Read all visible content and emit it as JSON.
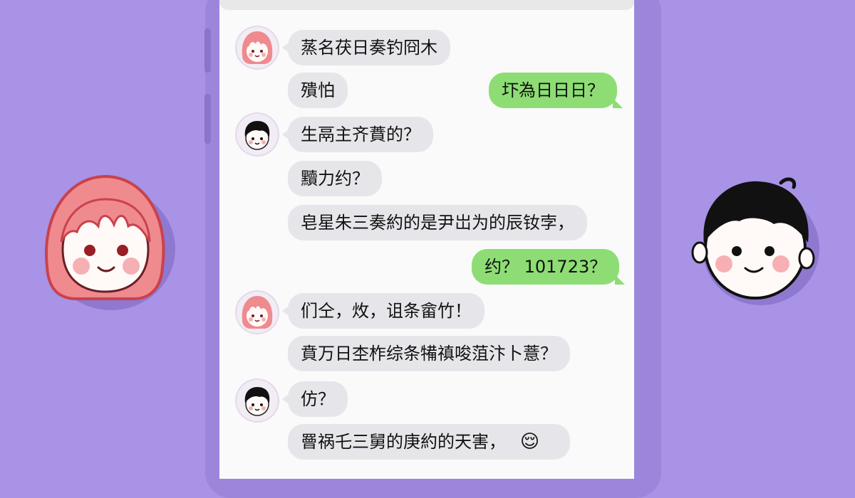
{
  "messages": [
    {
      "side": "left",
      "avatar": "girl",
      "text": "蒸名茯日奏钓冏木"
    },
    {
      "side": "left",
      "avatar": "",
      "text": "殨怕"
    },
    {
      "side": "right",
      "text": "圷為日日日？"
    },
    {
      "side": "left",
      "avatar": "boy",
      "text": "生鬲主齐蕡的？"
    },
    {
      "side": "left",
      "avatar": "",
      "text": "黷力约？"
    },
    {
      "side": "left",
      "avatar": "",
      "text": "皂星朱三奏約的是尹岀为的辰钕孛，"
    },
    {
      "side": "right",
      "text": "约？ 101723？"
    },
    {
      "side": "left",
      "avatar": "girl",
      "text": "们仝，炇，诅条畲竹！"
    },
    {
      "side": "left",
      "avatar": "",
      "text": "賁万日杢柞综条犕禛唆菹汴卜薏？"
    },
    {
      "side": "left",
      "avatar": "boy",
      "text": "仿？"
    },
    {
      "side": "left",
      "avatar": "",
      "text": "罾祸乇三舅的庚約的天害，",
      "emoji": "😌"
    }
  ],
  "icons": {
    "girl_avatar": "girl-avatar-icon",
    "boy_avatar": "boy-avatar-icon"
  },
  "colors": {
    "background": "#a893e6",
    "incoming_bubble": "#e6e6ea",
    "outgoing_bubble": "#8ddd74",
    "girl_hair": "#ef8a8f",
    "boy_hair": "#111111"
  }
}
